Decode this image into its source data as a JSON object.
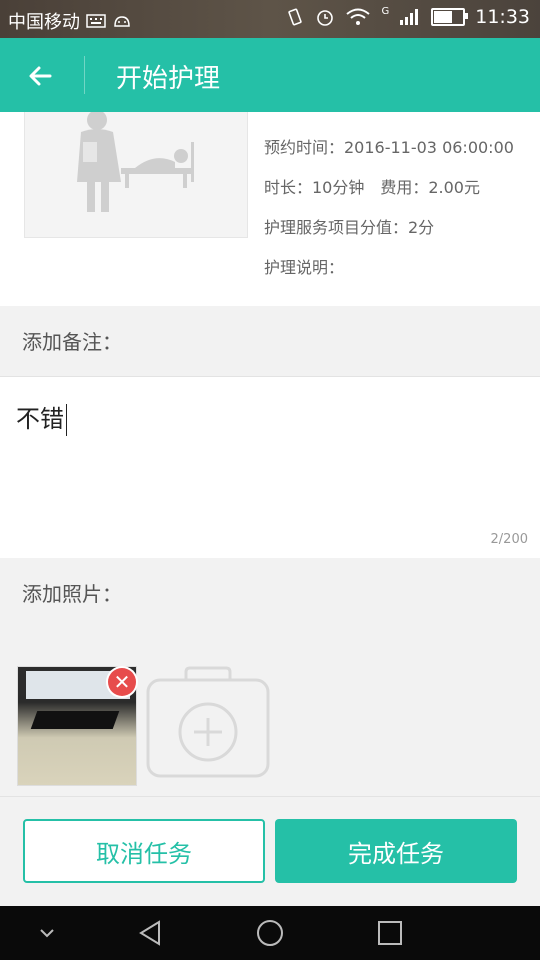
{
  "statusbar": {
    "carrier": "中国移动",
    "network_tag": "G",
    "time": "11:33",
    "battery_level": 0.6
  },
  "header": {
    "title": "开始护理"
  },
  "info": {
    "appointment_time": "预约时间：2016-11-03 06:00:00",
    "duration_fee": "时长：10分钟　费用：2.00元",
    "service_points": "护理服务项目分值：2分",
    "description": "护理说明："
  },
  "remarks": {
    "label": "添加备注：",
    "value": "不错",
    "counter": "2/200"
  },
  "photos": {
    "label": "添加照片："
  },
  "actions": {
    "cancel_label": "取消任务",
    "done_label": "完成任务"
  },
  "colors": {
    "accent": "#25c0a7",
    "remove": "#e74c4c"
  },
  "icons": [
    "back-arrow-icon",
    "camera-add-icon",
    "remove-icon",
    "nav-down-icon",
    "nav-back-icon",
    "nav-home-icon",
    "nav-recents-icon"
  ]
}
